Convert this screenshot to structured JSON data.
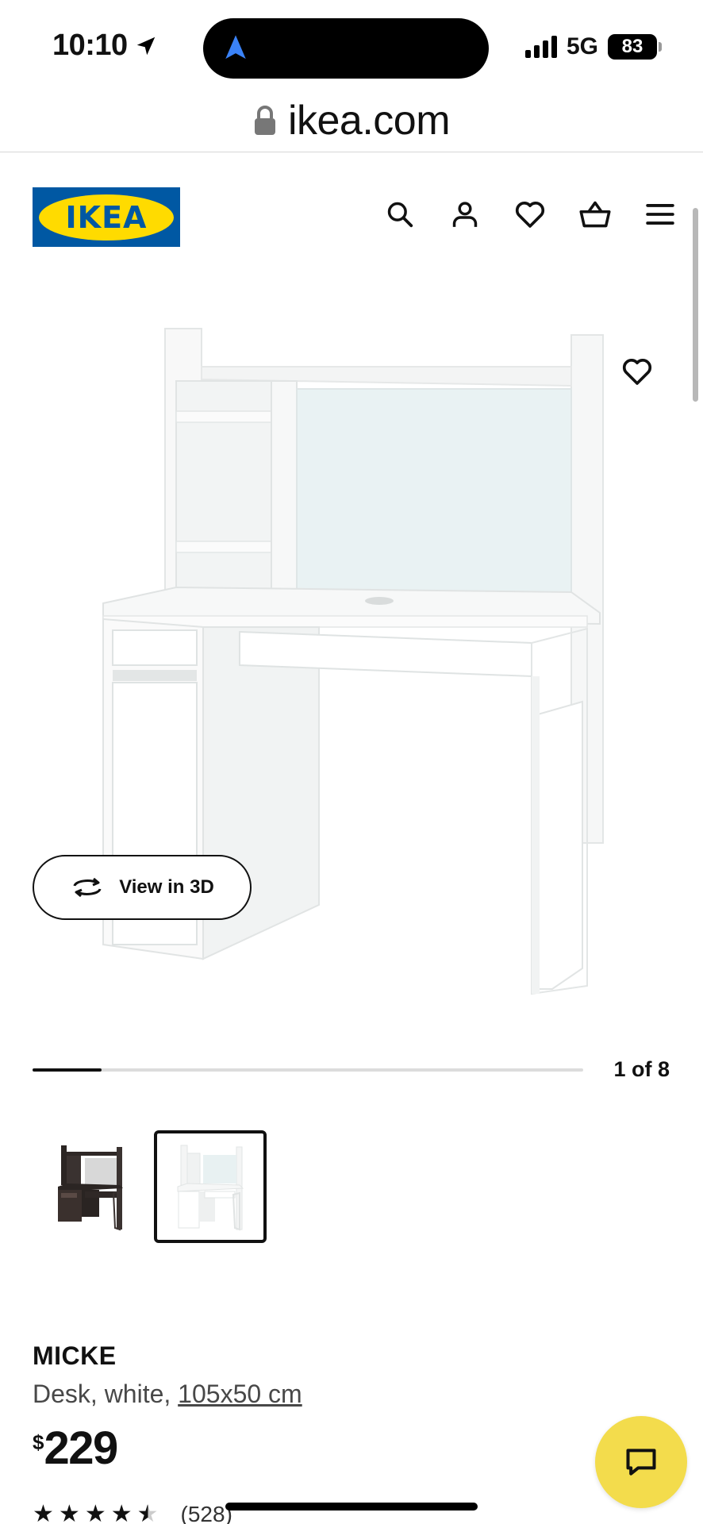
{
  "status_bar": {
    "time": "10:10",
    "network": "5G",
    "battery": "83"
  },
  "browser": {
    "url": "ikea.com"
  },
  "header": {
    "logo_text": "IKEA",
    "icons": [
      "search-icon",
      "account-icon",
      "heart-icon",
      "basket-icon",
      "menu-icon"
    ]
  },
  "gallery": {
    "view_3d_label": "View in 3D",
    "counter": "1 of 8",
    "progress": 0.125
  },
  "product": {
    "name": "MICKE",
    "description": "Desk, white, ",
    "dimensions": "105x50 cm",
    "currency": "$",
    "price": "229",
    "rating": 4.5,
    "review_count": "(528)"
  },
  "colors": {
    "ikea_blue": "#0058a3",
    "ikea_yellow": "#ffdb00",
    "chat_button": "#f3dc4c"
  }
}
